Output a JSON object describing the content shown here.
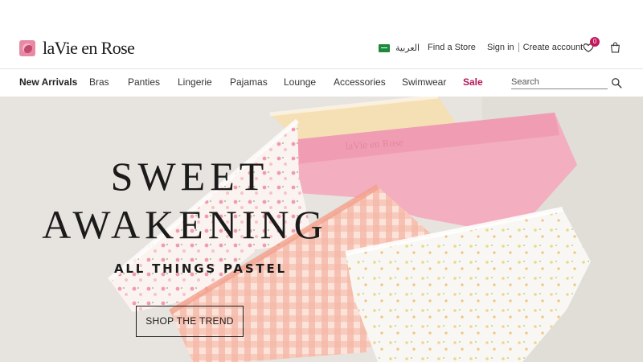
{
  "header": {
    "logo_text": "laVie en Rose",
    "language_label": "العربية",
    "find_store": "Find a Store",
    "sign_in": "Sign in",
    "create_account": "Create account",
    "wishlist_count": "0",
    "icons": [
      "flag-icon",
      "heart-icon",
      "bag-icon",
      "search-icon"
    ]
  },
  "nav": {
    "items": [
      "New Arrivals",
      "Bras",
      "Panties",
      "Lingerie",
      "Pajamas",
      "Lounge",
      "Accessories",
      "Swimwear",
      "Sale"
    ],
    "search_placeholder": "Search"
  },
  "hero": {
    "headline_1": "SWEET",
    "headline_2": "AWAKENING",
    "subheadline": "ALL THINGS PASTEL",
    "cta": "SHOP THE TREND",
    "band_text": "laVie en Rose"
  },
  "colors": {
    "accent": "#b0175a",
    "badge": "#c2185b",
    "pink": "#f3aec0",
    "peach": "#f1bfae",
    "cream": "#f5dfb5",
    "background": "#e6e2dd"
  }
}
